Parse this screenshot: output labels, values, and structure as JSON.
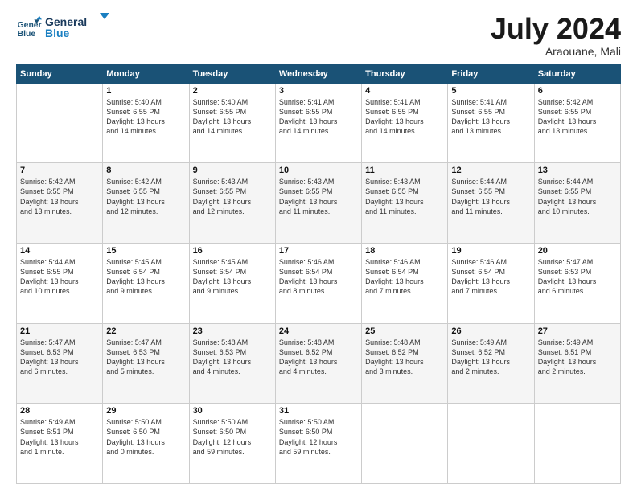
{
  "logo": {
    "line1": "General",
    "line2": "Blue"
  },
  "title": {
    "month_year": "July 2024",
    "location": "Araouane, Mali"
  },
  "headers": [
    "Sunday",
    "Monday",
    "Tuesday",
    "Wednesday",
    "Thursday",
    "Friday",
    "Saturday"
  ],
  "weeks": [
    [
      {
        "day": "",
        "info": ""
      },
      {
        "day": "1",
        "info": "Sunrise: 5:40 AM\nSunset: 6:55 PM\nDaylight: 13 hours\nand 14 minutes."
      },
      {
        "day": "2",
        "info": "Sunrise: 5:40 AM\nSunset: 6:55 PM\nDaylight: 13 hours\nand 14 minutes."
      },
      {
        "day": "3",
        "info": "Sunrise: 5:41 AM\nSunset: 6:55 PM\nDaylight: 13 hours\nand 14 minutes."
      },
      {
        "day": "4",
        "info": "Sunrise: 5:41 AM\nSunset: 6:55 PM\nDaylight: 13 hours\nand 14 minutes."
      },
      {
        "day": "5",
        "info": "Sunrise: 5:41 AM\nSunset: 6:55 PM\nDaylight: 13 hours\nand 13 minutes."
      },
      {
        "day": "6",
        "info": "Sunrise: 5:42 AM\nSunset: 6:55 PM\nDaylight: 13 hours\nand 13 minutes."
      }
    ],
    [
      {
        "day": "7",
        "info": "Sunrise: 5:42 AM\nSunset: 6:55 PM\nDaylight: 13 hours\nand 13 minutes."
      },
      {
        "day": "8",
        "info": "Sunrise: 5:42 AM\nSunset: 6:55 PM\nDaylight: 13 hours\nand 12 minutes."
      },
      {
        "day": "9",
        "info": "Sunrise: 5:43 AM\nSunset: 6:55 PM\nDaylight: 13 hours\nand 12 minutes."
      },
      {
        "day": "10",
        "info": "Sunrise: 5:43 AM\nSunset: 6:55 PM\nDaylight: 13 hours\nand 11 minutes."
      },
      {
        "day": "11",
        "info": "Sunrise: 5:43 AM\nSunset: 6:55 PM\nDaylight: 13 hours\nand 11 minutes."
      },
      {
        "day": "12",
        "info": "Sunrise: 5:44 AM\nSunset: 6:55 PM\nDaylight: 13 hours\nand 11 minutes."
      },
      {
        "day": "13",
        "info": "Sunrise: 5:44 AM\nSunset: 6:55 PM\nDaylight: 13 hours\nand 10 minutes."
      }
    ],
    [
      {
        "day": "14",
        "info": "Sunrise: 5:44 AM\nSunset: 6:55 PM\nDaylight: 13 hours\nand 10 minutes."
      },
      {
        "day": "15",
        "info": "Sunrise: 5:45 AM\nSunset: 6:54 PM\nDaylight: 13 hours\nand 9 minutes."
      },
      {
        "day": "16",
        "info": "Sunrise: 5:45 AM\nSunset: 6:54 PM\nDaylight: 13 hours\nand 9 minutes."
      },
      {
        "day": "17",
        "info": "Sunrise: 5:46 AM\nSunset: 6:54 PM\nDaylight: 13 hours\nand 8 minutes."
      },
      {
        "day": "18",
        "info": "Sunrise: 5:46 AM\nSunset: 6:54 PM\nDaylight: 13 hours\nand 7 minutes."
      },
      {
        "day": "19",
        "info": "Sunrise: 5:46 AM\nSunset: 6:54 PM\nDaylight: 13 hours\nand 7 minutes."
      },
      {
        "day": "20",
        "info": "Sunrise: 5:47 AM\nSunset: 6:53 PM\nDaylight: 13 hours\nand 6 minutes."
      }
    ],
    [
      {
        "day": "21",
        "info": "Sunrise: 5:47 AM\nSunset: 6:53 PM\nDaylight: 13 hours\nand 6 minutes."
      },
      {
        "day": "22",
        "info": "Sunrise: 5:47 AM\nSunset: 6:53 PM\nDaylight: 13 hours\nand 5 minutes."
      },
      {
        "day": "23",
        "info": "Sunrise: 5:48 AM\nSunset: 6:53 PM\nDaylight: 13 hours\nand 4 minutes."
      },
      {
        "day": "24",
        "info": "Sunrise: 5:48 AM\nSunset: 6:52 PM\nDaylight: 13 hours\nand 4 minutes."
      },
      {
        "day": "25",
        "info": "Sunrise: 5:48 AM\nSunset: 6:52 PM\nDaylight: 13 hours\nand 3 minutes."
      },
      {
        "day": "26",
        "info": "Sunrise: 5:49 AM\nSunset: 6:52 PM\nDaylight: 13 hours\nand 2 minutes."
      },
      {
        "day": "27",
        "info": "Sunrise: 5:49 AM\nSunset: 6:51 PM\nDaylight: 13 hours\nand 2 minutes."
      }
    ],
    [
      {
        "day": "28",
        "info": "Sunrise: 5:49 AM\nSunset: 6:51 PM\nDaylight: 13 hours\nand 1 minute."
      },
      {
        "day": "29",
        "info": "Sunrise: 5:50 AM\nSunset: 6:50 PM\nDaylight: 13 hours\nand 0 minutes."
      },
      {
        "day": "30",
        "info": "Sunrise: 5:50 AM\nSunset: 6:50 PM\nDaylight: 12 hours\nand 59 minutes."
      },
      {
        "day": "31",
        "info": "Sunrise: 5:50 AM\nSunset: 6:50 PM\nDaylight: 12 hours\nand 59 minutes."
      },
      {
        "day": "",
        "info": ""
      },
      {
        "day": "",
        "info": ""
      },
      {
        "day": "",
        "info": ""
      }
    ]
  ]
}
